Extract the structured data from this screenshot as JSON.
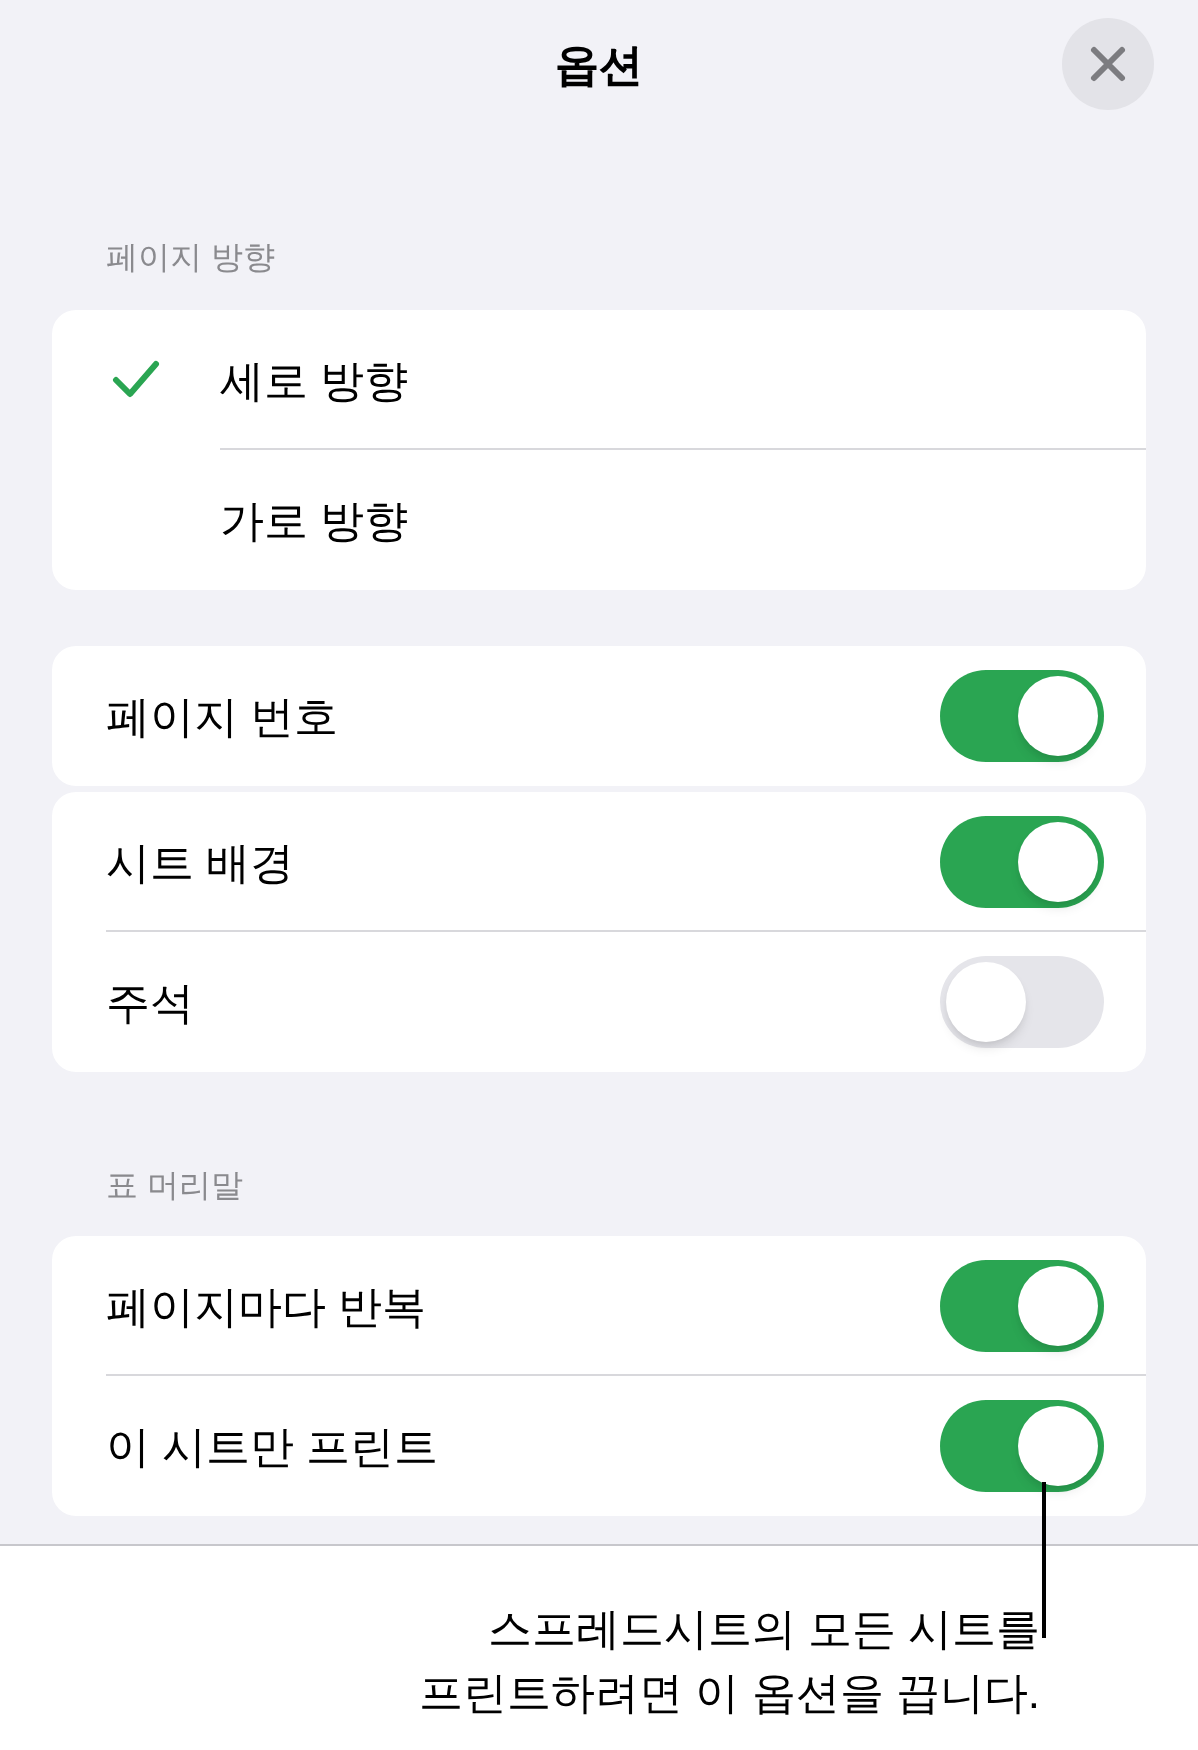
{
  "title": "옵션",
  "orientation": {
    "heading": "페이지 방향",
    "options": [
      {
        "label": "세로 방향",
        "selected": true
      },
      {
        "label": "가로 방향",
        "selected": false
      }
    ]
  },
  "groups": [
    [
      {
        "label": "페이지 번호",
        "on": true
      }
    ],
    [
      {
        "label": "시트 배경",
        "on": true
      },
      {
        "label": "주석",
        "on": false
      }
    ]
  ],
  "header_section": {
    "heading": "표 머리말",
    "toggles": [
      {
        "label": "페이지마다 반복",
        "on": true
      },
      {
        "label": "이 시트만 프린트",
        "on": true
      }
    ]
  },
  "callout": [
    "스프레드시트의 모든 시트를",
    "프린트하려면 이 옵션을 끕니다."
  ]
}
